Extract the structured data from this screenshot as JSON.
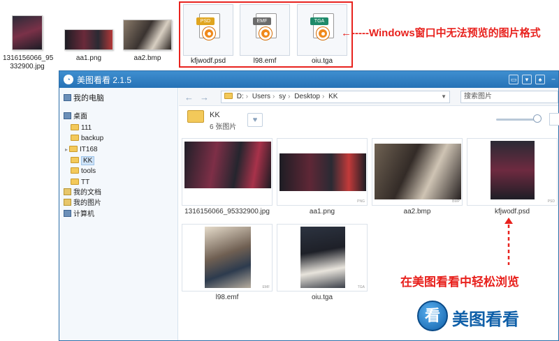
{
  "desktop_icons": [
    {
      "label_line1": "1316156066_95",
      "label_line2": "332900.jpg"
    },
    {
      "label_line1": "aa1.png",
      "label_line2": ""
    },
    {
      "label_line1": "aa2.bmp",
      "label_line2": ""
    }
  ],
  "format_icons": [
    {
      "tag": "PSD",
      "label": "kfjwodf.psd",
      "tag_color": "#e0a51f"
    },
    {
      "tag": "EMF",
      "label": "l98.emf",
      "tag_color": "#6b6b6b"
    },
    {
      "tag": "TGA",
      "label": "oiu.tga",
      "tag_color": "#1f8a6a"
    }
  ],
  "annotations": {
    "top_note": "←-----Windows窗口中无法预览的图片格式",
    "browse_note": "在美图看看中轻松浏览",
    "brand_char": "看",
    "brand_name": "美图看看"
  },
  "colors": {
    "accent_red": "#e8221e",
    "title_blue": "#2672b6",
    "brand_blue": "#0f5fa8"
  },
  "app": {
    "title": "美图看看 2.1.5",
    "sidebar": {
      "root": "我的电脑",
      "desktop": "桌面",
      "folders": [
        "111",
        "backup",
        "IT168",
        "KK",
        "tools",
        "TT"
      ],
      "selected": "KK",
      "others": [
        "我的文档",
        "我的图片",
        "计算机"
      ]
    },
    "toolbar": {
      "back": "←",
      "forward": "→",
      "path": [
        "D:",
        "Users",
        "sy",
        "Desktop",
        "KK"
      ],
      "search_placeholder": "搜索图片"
    },
    "folder": {
      "name": "KK",
      "count": "6 张图片"
    },
    "thumbnails": [
      {
        "label": "1316156066_95332900.jpg",
        "ext": ""
      },
      {
        "label": "aa1.png",
        "ext": "PNG"
      },
      {
        "label": "aa2.bmp",
        "ext": "BMP"
      },
      {
        "label": "kfjwodf.psd",
        "ext": "PSD"
      },
      {
        "label": "l98.emf",
        "ext": "EMF"
      },
      {
        "label": "oiu.tga",
        "ext": "TGA"
      }
    ]
  }
}
